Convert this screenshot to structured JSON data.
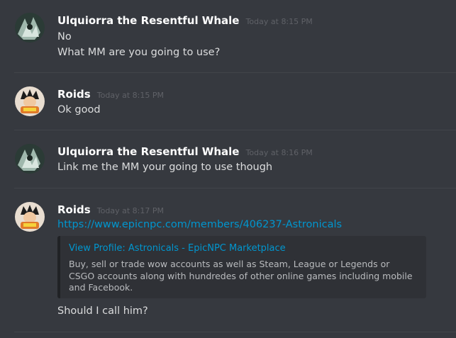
{
  "messages": [
    {
      "author": "Ulquiorra the Resentful Whale",
      "timestamp": "Today at 8:15 PM",
      "lines": [
        "No",
        "What MM are you going to use?"
      ]
    },
    {
      "author": "Roids",
      "timestamp": "Today at 8:15 PM",
      "lines": [
        "Ok good"
      ]
    },
    {
      "author": "Ulquiorra the Resentful Whale",
      "timestamp": "Today at 8:16 PM",
      "lines": [
        "Link me the MM your going to use though"
      ]
    },
    {
      "author": "Roids",
      "timestamp": "Today at 8:17 PM",
      "link": "https://www.epicnpc.com/members/406237-Astronicals",
      "embed": {
        "title": "View Profile: Astronicals - EpicNPC Marketplace",
        "description": "Buy, sell or trade wow accounts as well as Steam, League or Legends or CSGO accounts along with hundredes of other online games including mobile and Facebook."
      },
      "lines": [
        "Should I call him?"
      ]
    }
  ],
  "colors": {
    "background": "#36393f",
    "username": "#ffffff",
    "timestamp": "#5f6167",
    "link": "#0096cf",
    "embed_background": "#2f3136"
  }
}
